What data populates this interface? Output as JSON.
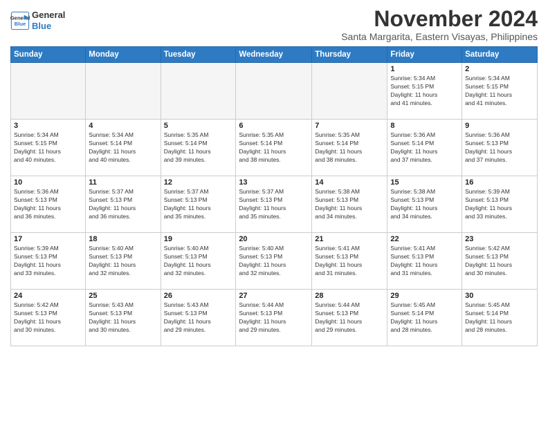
{
  "logo": {
    "line1": "General",
    "line2": "Blue"
  },
  "title": "November 2024",
  "location": "Santa Margarita, Eastern Visayas, Philippines",
  "days_of_week": [
    "Sunday",
    "Monday",
    "Tuesday",
    "Wednesday",
    "Thursday",
    "Friday",
    "Saturday"
  ],
  "weeks": [
    [
      {
        "day": "",
        "info": ""
      },
      {
        "day": "",
        "info": ""
      },
      {
        "day": "",
        "info": ""
      },
      {
        "day": "",
        "info": ""
      },
      {
        "day": "",
        "info": ""
      },
      {
        "day": "1",
        "info": "Sunrise: 5:34 AM\nSunset: 5:15 PM\nDaylight: 11 hours\nand 41 minutes."
      },
      {
        "day": "2",
        "info": "Sunrise: 5:34 AM\nSunset: 5:15 PM\nDaylight: 11 hours\nand 41 minutes."
      }
    ],
    [
      {
        "day": "3",
        "info": "Sunrise: 5:34 AM\nSunset: 5:15 PM\nDaylight: 11 hours\nand 40 minutes."
      },
      {
        "day": "4",
        "info": "Sunrise: 5:34 AM\nSunset: 5:14 PM\nDaylight: 11 hours\nand 40 minutes."
      },
      {
        "day": "5",
        "info": "Sunrise: 5:35 AM\nSunset: 5:14 PM\nDaylight: 11 hours\nand 39 minutes."
      },
      {
        "day": "6",
        "info": "Sunrise: 5:35 AM\nSunset: 5:14 PM\nDaylight: 11 hours\nand 38 minutes."
      },
      {
        "day": "7",
        "info": "Sunrise: 5:35 AM\nSunset: 5:14 PM\nDaylight: 11 hours\nand 38 minutes."
      },
      {
        "day": "8",
        "info": "Sunrise: 5:36 AM\nSunset: 5:14 PM\nDaylight: 11 hours\nand 37 minutes."
      },
      {
        "day": "9",
        "info": "Sunrise: 5:36 AM\nSunset: 5:13 PM\nDaylight: 11 hours\nand 37 minutes."
      }
    ],
    [
      {
        "day": "10",
        "info": "Sunrise: 5:36 AM\nSunset: 5:13 PM\nDaylight: 11 hours\nand 36 minutes."
      },
      {
        "day": "11",
        "info": "Sunrise: 5:37 AM\nSunset: 5:13 PM\nDaylight: 11 hours\nand 36 minutes."
      },
      {
        "day": "12",
        "info": "Sunrise: 5:37 AM\nSunset: 5:13 PM\nDaylight: 11 hours\nand 35 minutes."
      },
      {
        "day": "13",
        "info": "Sunrise: 5:37 AM\nSunset: 5:13 PM\nDaylight: 11 hours\nand 35 minutes."
      },
      {
        "day": "14",
        "info": "Sunrise: 5:38 AM\nSunset: 5:13 PM\nDaylight: 11 hours\nand 34 minutes."
      },
      {
        "day": "15",
        "info": "Sunrise: 5:38 AM\nSunset: 5:13 PM\nDaylight: 11 hours\nand 34 minutes."
      },
      {
        "day": "16",
        "info": "Sunrise: 5:39 AM\nSunset: 5:13 PM\nDaylight: 11 hours\nand 33 minutes."
      }
    ],
    [
      {
        "day": "17",
        "info": "Sunrise: 5:39 AM\nSunset: 5:13 PM\nDaylight: 11 hours\nand 33 minutes."
      },
      {
        "day": "18",
        "info": "Sunrise: 5:40 AM\nSunset: 5:13 PM\nDaylight: 11 hours\nand 32 minutes."
      },
      {
        "day": "19",
        "info": "Sunrise: 5:40 AM\nSunset: 5:13 PM\nDaylight: 11 hours\nand 32 minutes."
      },
      {
        "day": "20",
        "info": "Sunrise: 5:40 AM\nSunset: 5:13 PM\nDaylight: 11 hours\nand 32 minutes."
      },
      {
        "day": "21",
        "info": "Sunrise: 5:41 AM\nSunset: 5:13 PM\nDaylight: 11 hours\nand 31 minutes."
      },
      {
        "day": "22",
        "info": "Sunrise: 5:41 AM\nSunset: 5:13 PM\nDaylight: 11 hours\nand 31 minutes."
      },
      {
        "day": "23",
        "info": "Sunrise: 5:42 AM\nSunset: 5:13 PM\nDaylight: 11 hours\nand 30 minutes."
      }
    ],
    [
      {
        "day": "24",
        "info": "Sunrise: 5:42 AM\nSunset: 5:13 PM\nDaylight: 11 hours\nand 30 minutes."
      },
      {
        "day": "25",
        "info": "Sunrise: 5:43 AM\nSunset: 5:13 PM\nDaylight: 11 hours\nand 30 minutes."
      },
      {
        "day": "26",
        "info": "Sunrise: 5:43 AM\nSunset: 5:13 PM\nDaylight: 11 hours\nand 29 minutes."
      },
      {
        "day": "27",
        "info": "Sunrise: 5:44 AM\nSunset: 5:13 PM\nDaylight: 11 hours\nand 29 minutes."
      },
      {
        "day": "28",
        "info": "Sunrise: 5:44 AM\nSunset: 5:13 PM\nDaylight: 11 hours\nand 29 minutes."
      },
      {
        "day": "29",
        "info": "Sunrise: 5:45 AM\nSunset: 5:14 PM\nDaylight: 11 hours\nand 28 minutes."
      },
      {
        "day": "30",
        "info": "Sunrise: 5:45 AM\nSunset: 5:14 PM\nDaylight: 11 hours\nand 28 minutes."
      }
    ]
  ]
}
